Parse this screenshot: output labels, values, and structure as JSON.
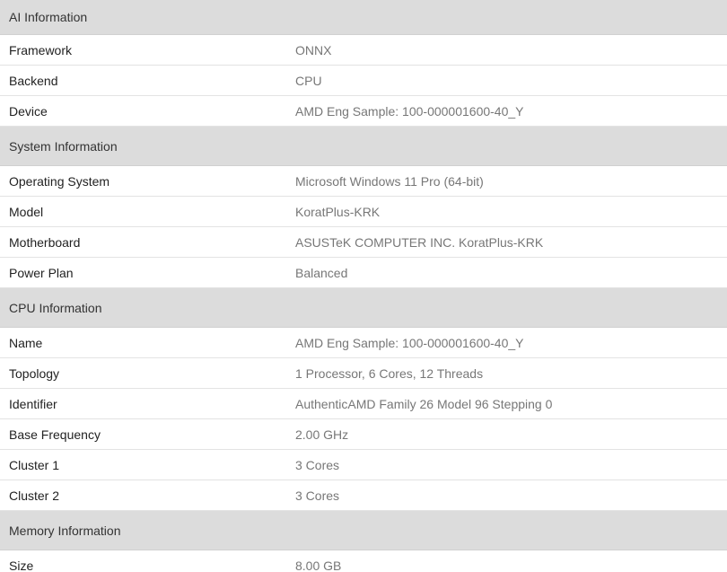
{
  "sections": [
    {
      "title": "AI Information",
      "rows": [
        {
          "key": "Framework",
          "value": "ONNX"
        },
        {
          "key": "Backend",
          "value": "CPU"
        },
        {
          "key": "Device",
          "value": "AMD Eng Sample: 100-000001600-40_Y"
        }
      ]
    },
    {
      "title": "System Information",
      "rows": [
        {
          "key": "Operating System",
          "value": "Microsoft Windows 11 Pro (64-bit)"
        },
        {
          "key": "Model",
          "value": "KoratPlus-KRK"
        },
        {
          "key": "Motherboard",
          "value": "ASUSTeK COMPUTER INC. KoratPlus-KRK"
        },
        {
          "key": "Power Plan",
          "value": "Balanced"
        }
      ]
    },
    {
      "title": "CPU Information",
      "rows": [
        {
          "key": "Name",
          "value": "AMD Eng Sample: 100-000001600-40_Y"
        },
        {
          "key": "Topology",
          "value": "1 Processor, 6 Cores, 12 Threads"
        },
        {
          "key": "Identifier",
          "value": "AuthenticAMD Family 26 Model 96 Stepping 0"
        },
        {
          "key": "Base Frequency",
          "value": "2.00 GHz"
        },
        {
          "key": "Cluster 1",
          "value": "3 Cores"
        },
        {
          "key": "Cluster 2",
          "value": "3 Cores"
        }
      ]
    },
    {
      "title": "Memory Information",
      "rows": [
        {
          "key": "Size",
          "value": "8.00 GB"
        }
      ]
    }
  ]
}
